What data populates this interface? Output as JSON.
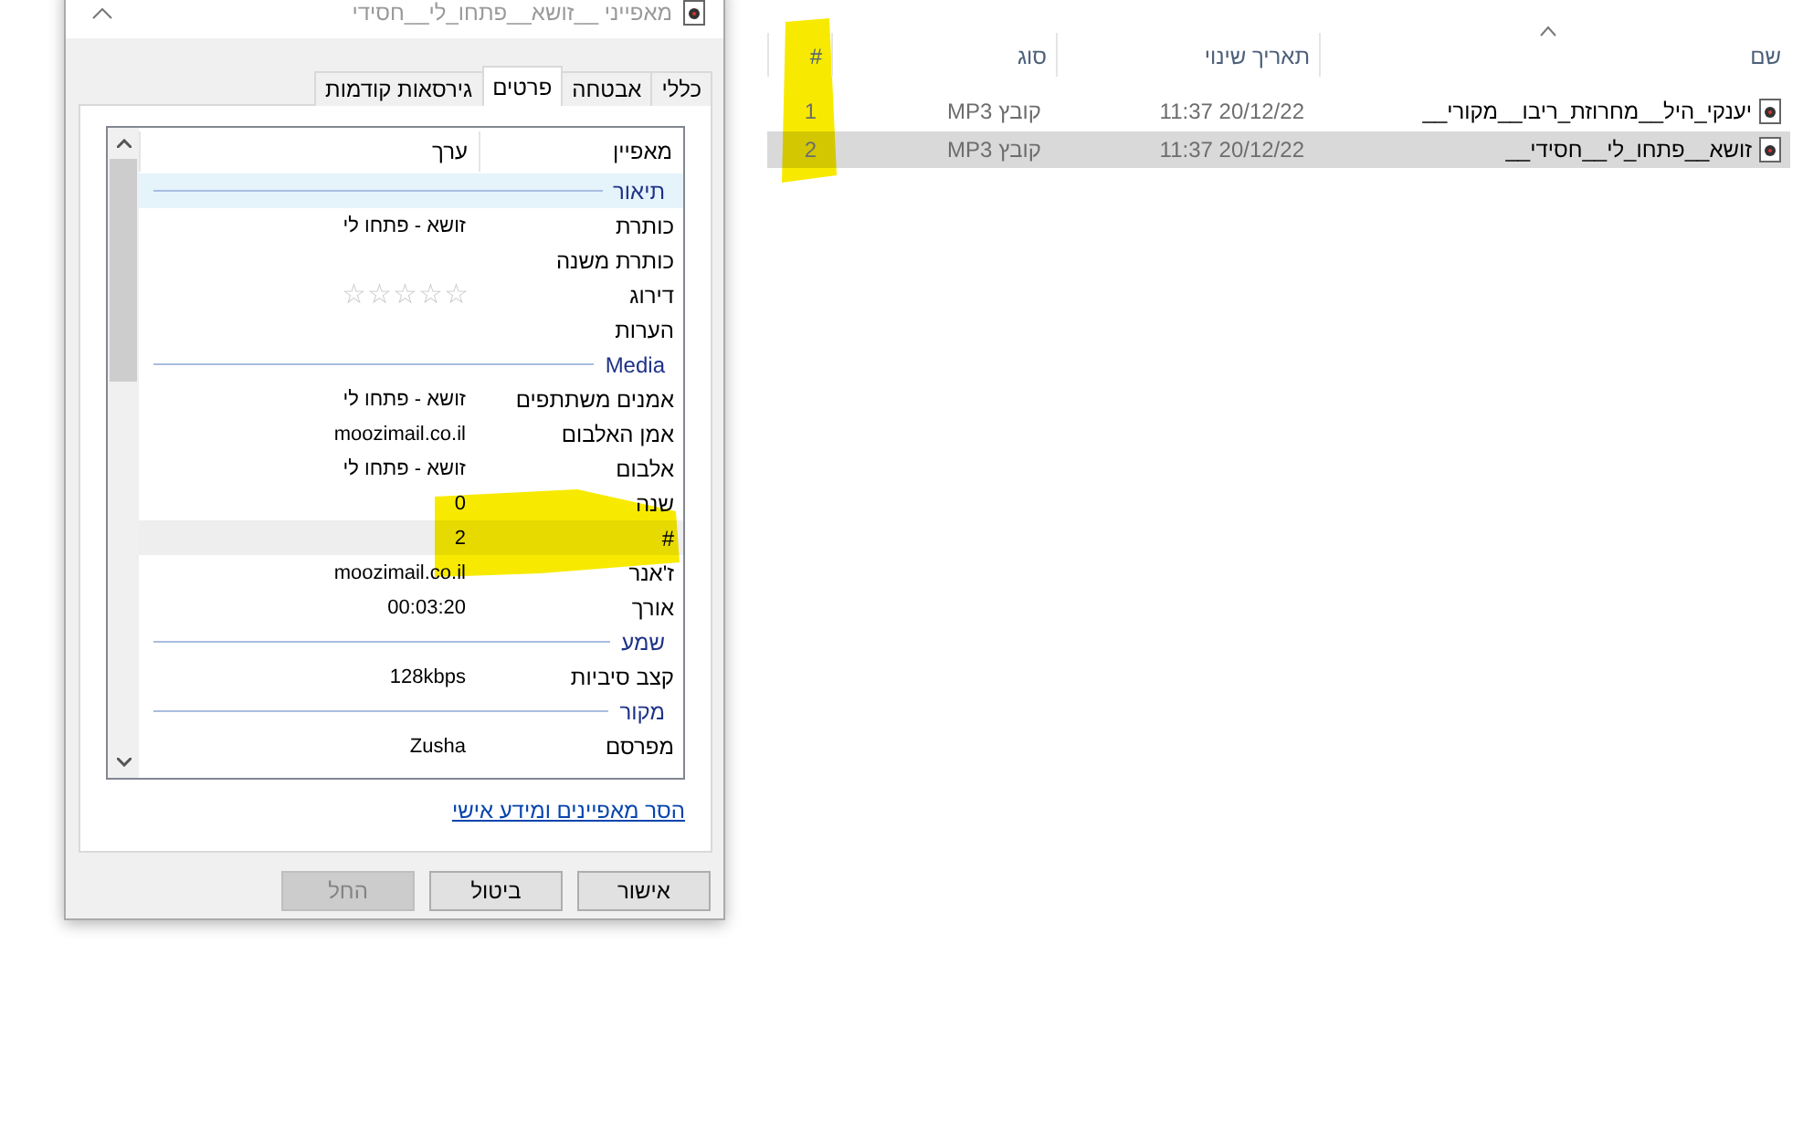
{
  "dialog": {
    "title": "מאפייני __זושא__פתחו_לי__חסידי",
    "tabs": [
      {
        "label": "כללי",
        "selected": false
      },
      {
        "label": "אבטחה",
        "selected": false
      },
      {
        "label": "פרטים",
        "selected": true
      },
      {
        "label": "גירסאות קודמות",
        "selected": false
      }
    ],
    "columns": [
      "מאפיין",
      "ערך"
    ],
    "rows": [
      {
        "kind": "group",
        "label": "תיאור",
        "selected": true
      },
      {
        "kind": "field",
        "label": "כותרת",
        "value": "זושא - פתחו לי",
        "selected": false
      },
      {
        "kind": "field",
        "label": "כותרת משנה",
        "selected": false
      },
      {
        "kind": "rating",
        "label": "דירוג",
        "stars": 0,
        "selected": false
      },
      {
        "kind": "field",
        "label": "הערות",
        "selected": false
      },
      {
        "kind": "group",
        "label": "Media",
        "selected": false
      },
      {
        "kind": "field",
        "label": "אמנים משתתפים",
        "value": "זושא - פתחו לי",
        "selected": false
      },
      {
        "kind": "field",
        "label": "אמן האלבום",
        "value": "moozimail.co.il",
        "selected": false
      },
      {
        "kind": "field",
        "label": "אלבום",
        "value": "זושא - פתחו לי",
        "selected": false
      },
      {
        "kind": "field",
        "label": "שנה",
        "value": "0",
        "selected": false
      },
      {
        "kind": "field",
        "label": "#",
        "value": "2",
        "selected": true
      },
      {
        "kind": "field",
        "label": "ז'אנר",
        "value": "moozimail.co.il",
        "selected": false
      },
      {
        "kind": "field",
        "label": "אורך",
        "value": "00:03:20",
        "selected": false
      },
      {
        "kind": "group",
        "label": "שמע",
        "selected": false
      },
      {
        "kind": "field",
        "label": "קצב סיביות",
        "value": "128kbps",
        "selected": false
      },
      {
        "kind": "group",
        "label": "מקור",
        "selected": false
      },
      {
        "kind": "field",
        "label": "מפרסם",
        "value": "Zusha",
        "selected": false
      }
    ],
    "link": "הסר מאפיינים ומידע אישי",
    "buttons": [
      {
        "label": "אישור",
        "disabled": false
      },
      {
        "label": "ביטול",
        "disabled": false
      },
      {
        "label": "החל",
        "disabled": true
      }
    ]
  },
  "explorer": {
    "columns": [
      "שם",
      "תאריך שינוי",
      "סוג",
      "#"
    ],
    "rows": [
      {
        "name": "יענקי_היל__מחרוזת_ריבו__מקורי__",
        "modified": "20/12/22 11:37",
        "type": "קובץ MP3",
        "number": "1",
        "selected": false
      },
      {
        "name": "זושא__פתחו_לי__חסידי__",
        "modified": "20/12/22 11:37",
        "type": "קובץ MP3",
        "number": "2",
        "selected": true
      }
    ]
  }
}
